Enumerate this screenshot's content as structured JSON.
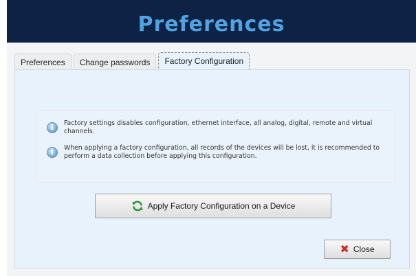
{
  "header": {
    "title": "Preferences"
  },
  "tabs": [
    {
      "label": "Preferences"
    },
    {
      "label": "Change passwords"
    },
    {
      "label": "Factory Configuration"
    }
  ],
  "info": [
    {
      "icon": "info-icon",
      "text": "Factory settings disables configuration, ethernet interface, all analog, digital, remote and virtual channels."
    },
    {
      "icon": "info-icon",
      "text": "When applying a factory configuration, all records of the devices will be lost, it is recommended to perform a data collection before applying this configuration."
    }
  ],
  "buttons": {
    "apply_label": "Apply Factory Configuration on a Device",
    "apply_icon": "refresh-icon",
    "close_label": "Close",
    "close_icon": "x-icon"
  },
  "colors": {
    "header_bg": "#0d2245",
    "header_text": "#4fa3e0",
    "panel_bg": "#e7f2fc",
    "close_icon": "#c8312a",
    "refresh_icon": "#2e9a3a"
  }
}
